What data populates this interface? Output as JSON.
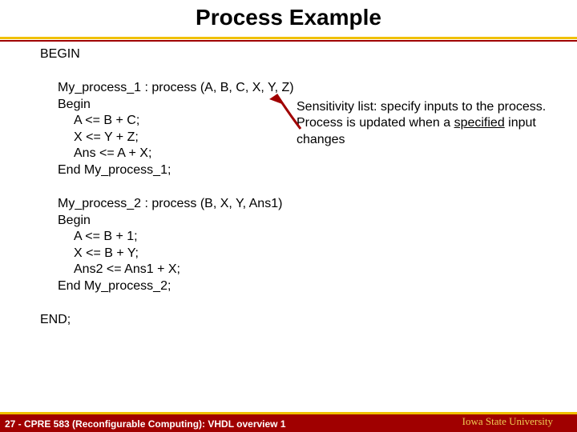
{
  "title": "Process Example",
  "body": {
    "begin": "BEGIN",
    "proc1": {
      "decl": "My_process_1 : process (A, B, C, X, Y, Z)",
      "begin": "Begin",
      "l1": "A <= B + C;",
      "l2": "X <= Y + Z;",
      "l3": "Ans <= A + X;",
      "end": "End My_process_1;"
    },
    "proc2": {
      "decl": "My_process_2 : process (B, X, Y, Ans1)",
      "begin": "Begin",
      "l1": "A <= B + 1;",
      "l2": "X <= B + Y;",
      "l3": "Ans2 <= Ans1 + X;",
      "end": "End My_process_2;"
    },
    "end": "END;"
  },
  "annotation": {
    "p1a": "Sensitivity list: specify inputs to the process.  Process is updated when a ",
    "p1b": "specified",
    "p1c": " input changes"
  },
  "footer": {
    "left": "27 - CPRE 583 (Reconfigurable Computing):  VHDL overview 1",
    "right": "Iowa State University"
  }
}
